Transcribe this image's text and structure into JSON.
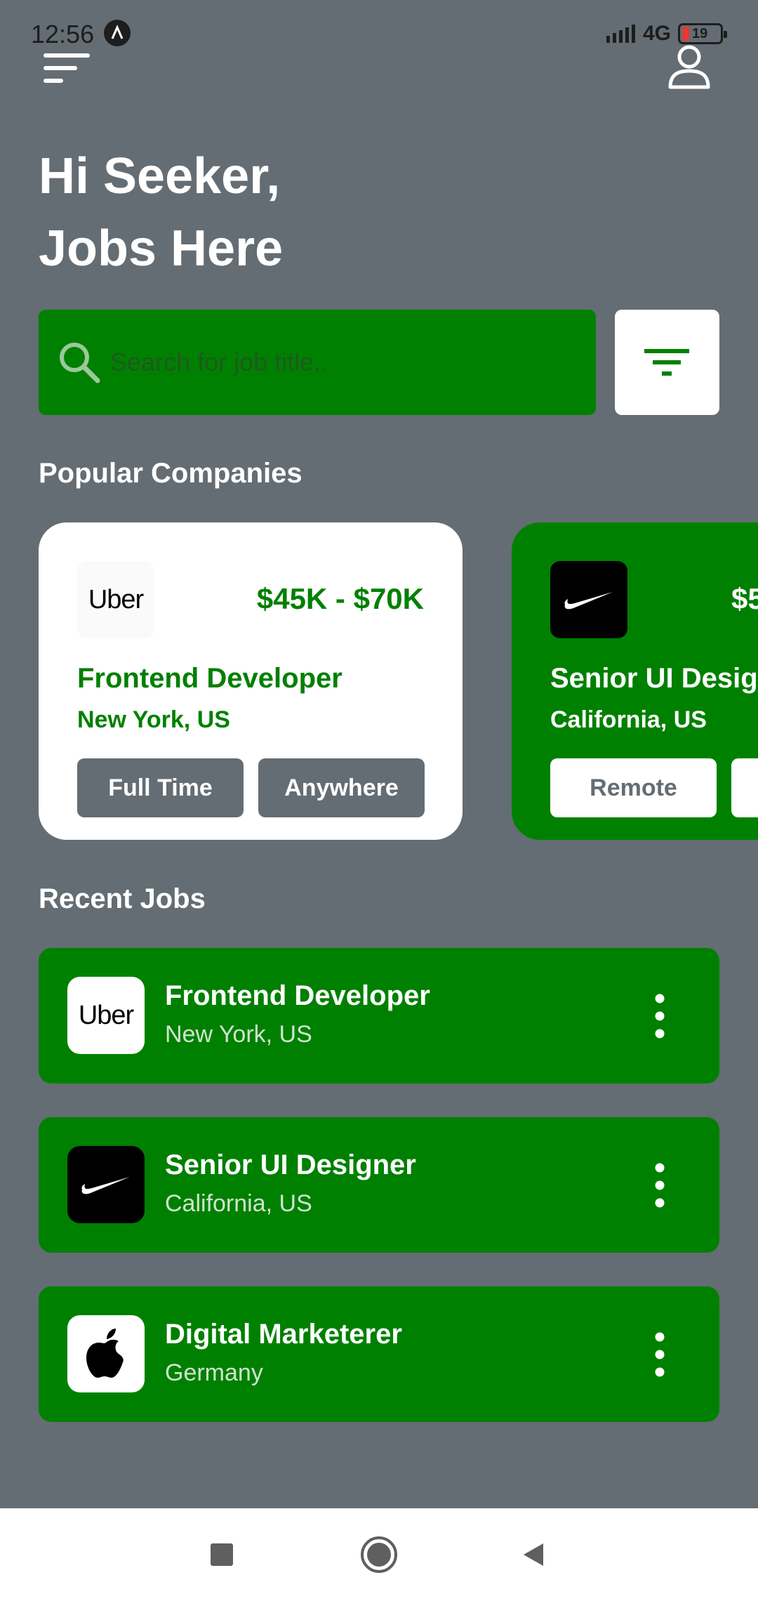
{
  "status": {
    "time": "12:56",
    "network": "4G",
    "battery": "19"
  },
  "greeting": {
    "line1": "Hi Seeker,",
    "line2": "Jobs Here"
  },
  "search": {
    "placeholder": "Search for job title.."
  },
  "sections": {
    "popular": "Popular Companies",
    "recent": "Recent Jobs"
  },
  "popular_companies": [
    {
      "logo": "Uber",
      "salary": "$45K - $70K",
      "title": "Frontend Developer",
      "location": "New York, US",
      "tags": [
        "Full Time",
        "Anywhere"
      ]
    },
    {
      "logo": "nike-swoosh-icon",
      "salary": "$5",
      "title": "Senior UI Designer",
      "location": "California, US",
      "tags": [
        "Remote",
        ""
      ]
    }
  ],
  "recent_jobs": [
    {
      "logo": "Uber",
      "title": "Frontend Developer",
      "location": "New York, US"
    },
    {
      "logo": "nike-swoosh-icon",
      "title": "Senior UI Designer",
      "location": "California, US"
    },
    {
      "logo": "apple-icon",
      "title": "Digital Marketerer",
      "location": "Germany"
    }
  ],
  "colors": {
    "background": "#646d73",
    "accent": "#008000",
    "surface": "#ffffff"
  }
}
